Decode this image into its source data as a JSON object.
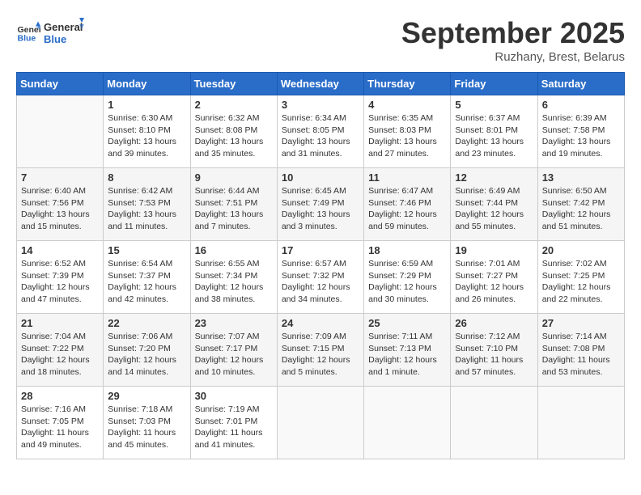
{
  "header": {
    "logo_general": "General",
    "logo_blue": "Blue",
    "month": "September 2025",
    "location": "Ruzhany, Brest, Belarus"
  },
  "days_of_week": [
    "Sunday",
    "Monday",
    "Tuesday",
    "Wednesday",
    "Thursday",
    "Friday",
    "Saturday"
  ],
  "weeks": [
    [
      {
        "day": "",
        "info": ""
      },
      {
        "day": "1",
        "info": "Sunrise: 6:30 AM\nSunset: 8:10 PM\nDaylight: 13 hours\nand 39 minutes."
      },
      {
        "day": "2",
        "info": "Sunrise: 6:32 AM\nSunset: 8:08 PM\nDaylight: 13 hours\nand 35 minutes."
      },
      {
        "day": "3",
        "info": "Sunrise: 6:34 AM\nSunset: 8:05 PM\nDaylight: 13 hours\nand 31 minutes."
      },
      {
        "day": "4",
        "info": "Sunrise: 6:35 AM\nSunset: 8:03 PM\nDaylight: 13 hours\nand 27 minutes."
      },
      {
        "day": "5",
        "info": "Sunrise: 6:37 AM\nSunset: 8:01 PM\nDaylight: 13 hours\nand 23 minutes."
      },
      {
        "day": "6",
        "info": "Sunrise: 6:39 AM\nSunset: 7:58 PM\nDaylight: 13 hours\nand 19 minutes."
      }
    ],
    [
      {
        "day": "7",
        "info": "Sunrise: 6:40 AM\nSunset: 7:56 PM\nDaylight: 13 hours\nand 15 minutes."
      },
      {
        "day": "8",
        "info": "Sunrise: 6:42 AM\nSunset: 7:53 PM\nDaylight: 13 hours\nand 11 minutes."
      },
      {
        "day": "9",
        "info": "Sunrise: 6:44 AM\nSunset: 7:51 PM\nDaylight: 13 hours\nand 7 minutes."
      },
      {
        "day": "10",
        "info": "Sunrise: 6:45 AM\nSunset: 7:49 PM\nDaylight: 13 hours\nand 3 minutes."
      },
      {
        "day": "11",
        "info": "Sunrise: 6:47 AM\nSunset: 7:46 PM\nDaylight: 12 hours\nand 59 minutes."
      },
      {
        "day": "12",
        "info": "Sunrise: 6:49 AM\nSunset: 7:44 PM\nDaylight: 12 hours\nand 55 minutes."
      },
      {
        "day": "13",
        "info": "Sunrise: 6:50 AM\nSunset: 7:42 PM\nDaylight: 12 hours\nand 51 minutes."
      }
    ],
    [
      {
        "day": "14",
        "info": "Sunrise: 6:52 AM\nSunset: 7:39 PM\nDaylight: 12 hours\nand 47 minutes."
      },
      {
        "day": "15",
        "info": "Sunrise: 6:54 AM\nSunset: 7:37 PM\nDaylight: 12 hours\nand 42 minutes."
      },
      {
        "day": "16",
        "info": "Sunrise: 6:55 AM\nSunset: 7:34 PM\nDaylight: 12 hours\nand 38 minutes."
      },
      {
        "day": "17",
        "info": "Sunrise: 6:57 AM\nSunset: 7:32 PM\nDaylight: 12 hours\nand 34 minutes."
      },
      {
        "day": "18",
        "info": "Sunrise: 6:59 AM\nSunset: 7:29 PM\nDaylight: 12 hours\nand 30 minutes."
      },
      {
        "day": "19",
        "info": "Sunrise: 7:01 AM\nSunset: 7:27 PM\nDaylight: 12 hours\nand 26 minutes."
      },
      {
        "day": "20",
        "info": "Sunrise: 7:02 AM\nSunset: 7:25 PM\nDaylight: 12 hours\nand 22 minutes."
      }
    ],
    [
      {
        "day": "21",
        "info": "Sunrise: 7:04 AM\nSunset: 7:22 PM\nDaylight: 12 hours\nand 18 minutes."
      },
      {
        "day": "22",
        "info": "Sunrise: 7:06 AM\nSunset: 7:20 PM\nDaylight: 12 hours\nand 14 minutes."
      },
      {
        "day": "23",
        "info": "Sunrise: 7:07 AM\nSunset: 7:17 PM\nDaylight: 12 hours\nand 10 minutes."
      },
      {
        "day": "24",
        "info": "Sunrise: 7:09 AM\nSunset: 7:15 PM\nDaylight: 12 hours\nand 5 minutes."
      },
      {
        "day": "25",
        "info": "Sunrise: 7:11 AM\nSunset: 7:13 PM\nDaylight: 12 hours\nand 1 minute."
      },
      {
        "day": "26",
        "info": "Sunrise: 7:12 AM\nSunset: 7:10 PM\nDaylight: 11 hours\nand 57 minutes."
      },
      {
        "day": "27",
        "info": "Sunrise: 7:14 AM\nSunset: 7:08 PM\nDaylight: 11 hours\nand 53 minutes."
      }
    ],
    [
      {
        "day": "28",
        "info": "Sunrise: 7:16 AM\nSunset: 7:05 PM\nDaylight: 11 hours\nand 49 minutes."
      },
      {
        "day": "29",
        "info": "Sunrise: 7:18 AM\nSunset: 7:03 PM\nDaylight: 11 hours\nand 45 minutes."
      },
      {
        "day": "30",
        "info": "Sunrise: 7:19 AM\nSunset: 7:01 PM\nDaylight: 11 hours\nand 41 minutes."
      },
      {
        "day": "",
        "info": ""
      },
      {
        "day": "",
        "info": ""
      },
      {
        "day": "",
        "info": ""
      },
      {
        "day": "",
        "info": ""
      }
    ]
  ]
}
